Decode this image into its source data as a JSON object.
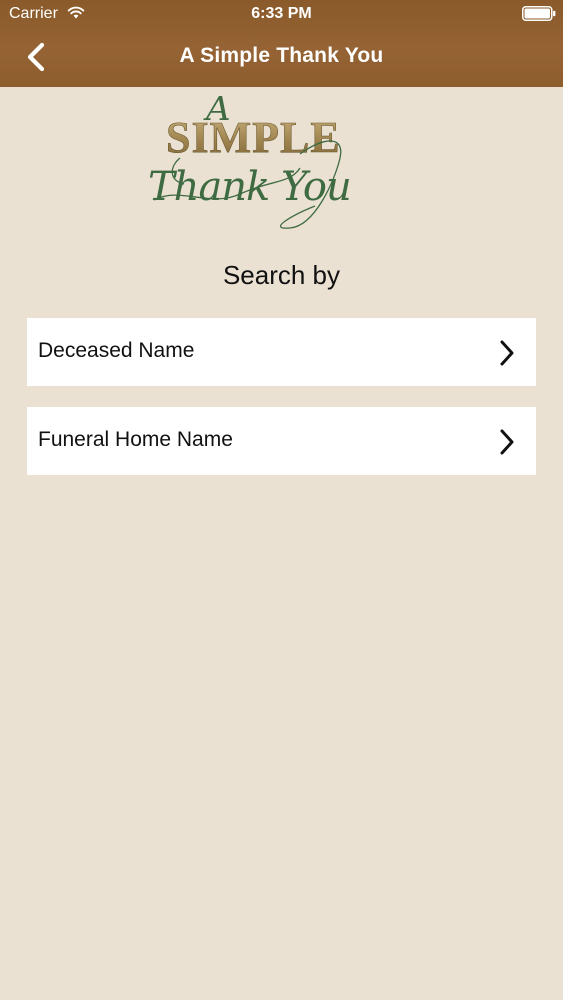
{
  "status_bar": {
    "carrier": "Carrier",
    "time": "6:33 PM"
  },
  "nav": {
    "title": "A Simple Thank You",
    "back_icon": "chevron-left-icon"
  },
  "logo": {
    "line1": "A",
    "line2": "SIMPLE",
    "line3": "Thank You"
  },
  "search": {
    "heading": "Search by",
    "options": [
      {
        "label": "Deceased Name",
        "icon": "chevron-right-icon"
      },
      {
        "label": "Funeral Home Name",
        "icon": "chevron-right-icon"
      }
    ]
  },
  "colors": {
    "nav_background": "#8f5e2f",
    "page_background": "#eae1d2",
    "logo_gold": "#a08550",
    "logo_green": "#3f6b42"
  }
}
